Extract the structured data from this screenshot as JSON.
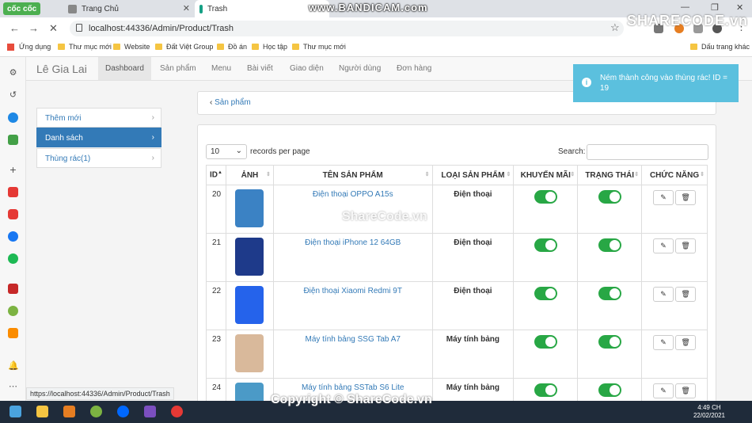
{
  "browser": {
    "brand": "cốc cốc",
    "tabs": [
      {
        "title": "Trang Chủ",
        "color": "#777"
      },
      {
        "title": "Trash",
        "color": "#16a085"
      }
    ],
    "recorder": "www.BANDICAM.com",
    "url": "localhost:44336/Admin/Product/Trash",
    "watermark_logo": "SHARECODE.vn",
    "bookmarks": [
      "Ứng dụng",
      "Thư mục mới",
      "Website",
      "Đất Việt Group",
      "Đồ án",
      "Học tập",
      "Thư mục mới"
    ],
    "bookmarks_right": "Dấu trang khác",
    "status_url": "https://localhost:44336/Admin/Product/Trash"
  },
  "app": {
    "brand": "Lê Gia Lai",
    "nav": [
      "Dashboard",
      "Sản phẩm",
      "Menu",
      "Bài viết",
      "Giao diện",
      "Người dùng",
      "Đơn hàng"
    ],
    "side_menu": [
      "Thêm mới",
      "Danh sách",
      "Thùng rác(1)"
    ],
    "back_link": "Sản phẩm",
    "toast": "Ném thành công vào thùng rác! ID = 19"
  },
  "table": {
    "length_value": "10",
    "length_text": "records per page",
    "search_label": "Search:",
    "headers": [
      "ID",
      "ẢNH",
      "TÊN SẢN PHẨM",
      "LOẠI SẢN PHẨM",
      "KHUYẾN MÃI",
      "TRẠNG THÁI",
      "CHỨC NĂNG"
    ],
    "rows": [
      {
        "id": "20",
        "name": "Điện thoại OPPO A15s",
        "category": "Điện thoại",
        "promo": true,
        "status": true,
        "thumb": "#3b82c4"
      },
      {
        "id": "21",
        "name": "Điện thoại iPhone 12 64GB",
        "category": "Điện thoại",
        "promo": true,
        "status": true,
        "thumb": "#1e3a8a"
      },
      {
        "id": "22",
        "name": "Điện thoại Xiaomi Redmi 9T",
        "category": "Điện thoại",
        "promo": true,
        "status": true,
        "thumb": "#2563eb"
      },
      {
        "id": "23",
        "name": "Máy tính bảng SSG Tab A7",
        "category": "Máy tính bảng",
        "promo": true,
        "status": true,
        "thumb": "#d9b99b"
      },
      {
        "id": "24",
        "name": "Máy tính bảng SSTab S6 Lite",
        "category": "Máy tính bảng",
        "promo": true,
        "status": true,
        "thumb": "#4b9ac7"
      }
    ]
  },
  "watermarks": {
    "center": "ShareCode.vn",
    "bottom": "Copyright © ShareCode.vn"
  },
  "taskbar": {
    "time": "4:49 CH",
    "date": "22/02/2021"
  },
  "colors": {
    "accent": "#337ab7",
    "toggle": "#28a745",
    "toast": "#5bc0de"
  }
}
